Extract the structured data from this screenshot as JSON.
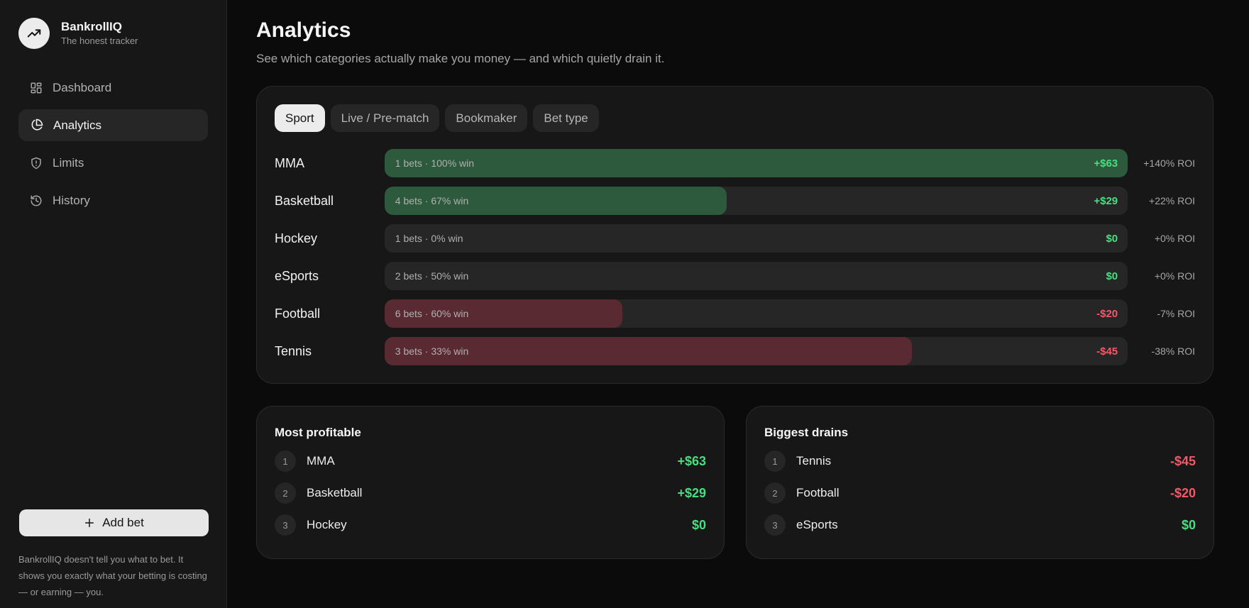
{
  "brand": {
    "name": "BankrollIQ",
    "tagline": "The honest tracker"
  },
  "nav": {
    "dashboard": "Dashboard",
    "analytics": "Analytics",
    "limits": "Limits",
    "history": "History"
  },
  "sidebar": {
    "add_bet": "Add bet",
    "footer": "BankrollIQ doesn't tell you what to bet. It shows you exactly what your betting is costing — or earning — you."
  },
  "page": {
    "title": "Analytics",
    "subtitle": "See which categories actually make you money — and which quietly drain it."
  },
  "tabs": [
    "Sport",
    "Live / Pre-match",
    "Bookmaker",
    "Bet type"
  ],
  "colors": {
    "positive": "#4ade80",
    "negative": "#f05a67",
    "bar_pos": "#2d5a3c",
    "bar_neg": "#5a2a32"
  },
  "breakdown": [
    {
      "label": "MMA",
      "meta": "1 bets · 100% win",
      "pnl": "+$63",
      "roi": "+140% ROI",
      "fill": 1.0,
      "sign": "pos"
    },
    {
      "label": "Basketball",
      "meta": "4 bets · 67% win",
      "pnl": "+$29",
      "roi": "+22% ROI",
      "fill": 0.46,
      "sign": "pos"
    },
    {
      "label": "Hockey",
      "meta": "1 bets · 0% win",
      "pnl": "$0",
      "roi": "+0% ROI",
      "fill": 0,
      "sign": "pos"
    },
    {
      "label": "eSports",
      "meta": "2 bets · 50% win",
      "pnl": "$0",
      "roi": "+0% ROI",
      "fill": 0,
      "sign": "pos"
    },
    {
      "label": "Football",
      "meta": "6 bets · 60% win",
      "pnl": "-$20",
      "roi": "-7% ROI",
      "fill": 0.32,
      "sign": "neg"
    },
    {
      "label": "Tennis",
      "meta": "3 bets · 33% win",
      "pnl": "-$45",
      "roi": "-38% ROI",
      "fill": 0.71,
      "sign": "neg"
    }
  ],
  "most_profitable": {
    "title": "Most profitable",
    "items": [
      {
        "rank": "1",
        "name": "MMA",
        "value": "+$63",
        "sign": "pos"
      },
      {
        "rank": "2",
        "name": "Basketball",
        "value": "+$29",
        "sign": "pos"
      },
      {
        "rank": "3",
        "name": "Hockey",
        "value": "$0",
        "sign": "pos"
      }
    ]
  },
  "biggest_drains": {
    "title": "Biggest drains",
    "items": [
      {
        "rank": "1",
        "name": "Tennis",
        "value": "-$45",
        "sign": "neg"
      },
      {
        "rank": "2",
        "name": "Football",
        "value": "-$20",
        "sign": "neg"
      },
      {
        "rank": "3",
        "name": "eSports",
        "value": "$0",
        "sign": "pos"
      }
    ]
  }
}
